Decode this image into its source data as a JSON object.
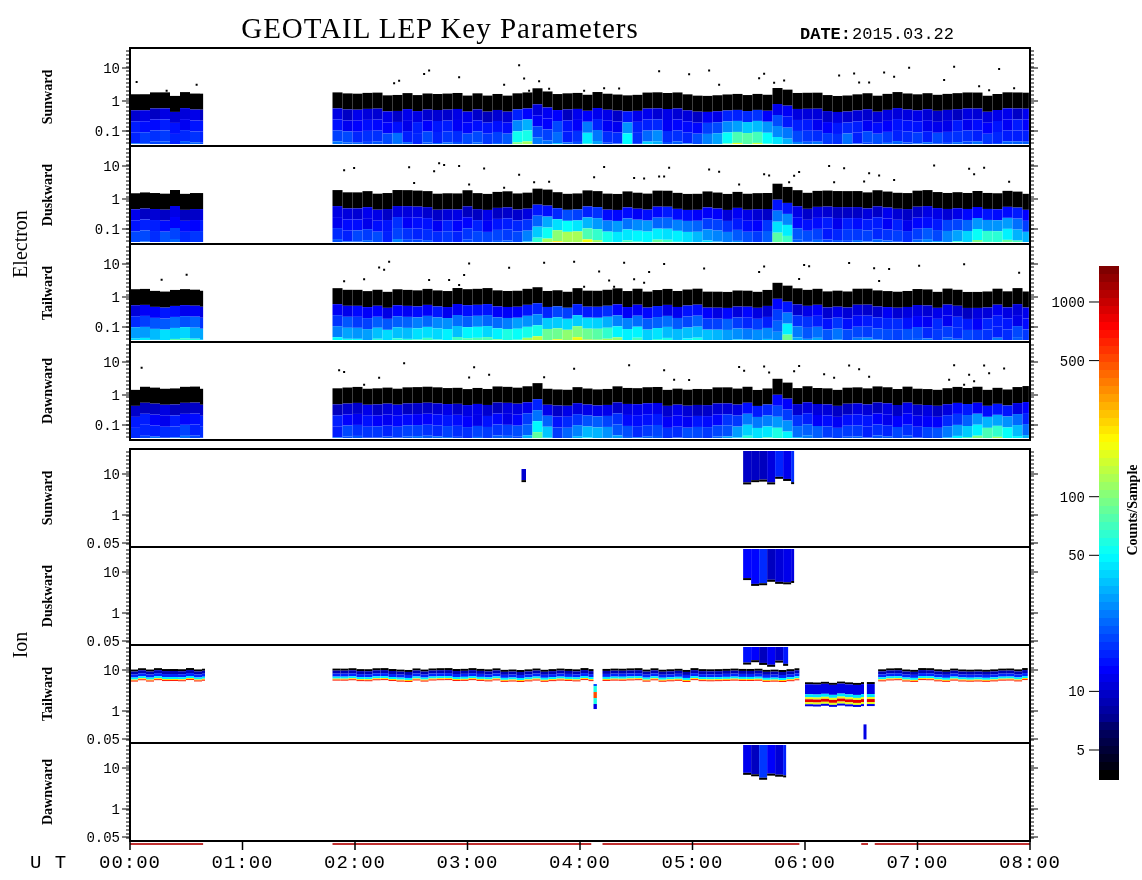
{
  "title": "GEOTAIL LEP Key Parameters",
  "date_label": "DATE:",
  "date": "2015.03.22",
  "groups": [
    {
      "label": "Electron",
      "kind": "electron",
      "panels": [
        {
          "label": "Sunward",
          "yticks": [
            "10",
            "1",
            "0.1"
          ]
        },
        {
          "label": "Duskward",
          "yticks": [
            "10",
            "1",
            "0.1"
          ]
        },
        {
          "label": "Tailward",
          "yticks": [
            "10",
            "1",
            "0.1"
          ]
        },
        {
          "label": "Dawnward",
          "yticks": [
            "10",
            "1",
            "0.1"
          ]
        }
      ]
    },
    {
      "label": "Ion",
      "kind": "ion",
      "panels": [
        {
          "label": "Sunward",
          "yticks": [
            "10",
            "1",
            "0.05"
          ]
        },
        {
          "label": "Duskward",
          "yticks": [
            "10",
            "1",
            "0.05"
          ]
        },
        {
          "label": "Tailward",
          "yticks": [
            "10",
            "1",
            "0.05"
          ]
        },
        {
          "label": "Dawnward",
          "yticks": [
            "10",
            "1",
            "0.05"
          ]
        }
      ]
    }
  ],
  "colorbar": {
    "label": "Counts/Sample",
    "ticks": [
      "1000",
      "500",
      "100",
      "50",
      "10",
      "5"
    ]
  },
  "x_axis": {
    "label": "U T",
    "ticks": [
      "00:00",
      "01:00",
      "02:00",
      "03:00",
      "04:00",
      "05:00",
      "06:00",
      "07:00",
      "08:00"
    ]
  }
}
